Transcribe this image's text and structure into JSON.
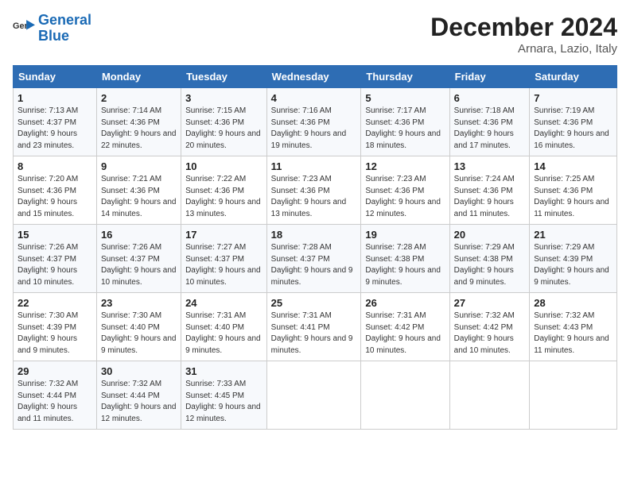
{
  "logo": {
    "line1": "General",
    "line2": "Blue"
  },
  "title": {
    "month_year": "December 2024",
    "location": "Arnara, Lazio, Italy"
  },
  "days_of_week": [
    "Sunday",
    "Monday",
    "Tuesday",
    "Wednesday",
    "Thursday",
    "Friday",
    "Saturday"
  ],
  "weeks": [
    [
      {
        "day": "1",
        "sunrise": "7:13 AM",
        "sunset": "4:37 PM",
        "daylight": "9 hours and 23 minutes."
      },
      {
        "day": "2",
        "sunrise": "7:14 AM",
        "sunset": "4:36 PM",
        "daylight": "9 hours and 22 minutes."
      },
      {
        "day": "3",
        "sunrise": "7:15 AM",
        "sunset": "4:36 PM",
        "daylight": "9 hours and 20 minutes."
      },
      {
        "day": "4",
        "sunrise": "7:16 AM",
        "sunset": "4:36 PM",
        "daylight": "9 hours and 19 minutes."
      },
      {
        "day": "5",
        "sunrise": "7:17 AM",
        "sunset": "4:36 PM",
        "daylight": "9 hours and 18 minutes."
      },
      {
        "day": "6",
        "sunrise": "7:18 AM",
        "sunset": "4:36 PM",
        "daylight": "9 hours and 17 minutes."
      },
      {
        "day": "7",
        "sunrise": "7:19 AM",
        "sunset": "4:36 PM",
        "daylight": "9 hours and 16 minutes."
      }
    ],
    [
      {
        "day": "8",
        "sunrise": "7:20 AM",
        "sunset": "4:36 PM",
        "daylight": "9 hours and 15 minutes."
      },
      {
        "day": "9",
        "sunrise": "7:21 AM",
        "sunset": "4:36 PM",
        "daylight": "9 hours and 14 minutes."
      },
      {
        "day": "10",
        "sunrise": "7:22 AM",
        "sunset": "4:36 PM",
        "daylight": "9 hours and 13 minutes."
      },
      {
        "day": "11",
        "sunrise": "7:23 AM",
        "sunset": "4:36 PM",
        "daylight": "9 hours and 13 minutes."
      },
      {
        "day": "12",
        "sunrise": "7:23 AM",
        "sunset": "4:36 PM",
        "daylight": "9 hours and 12 minutes."
      },
      {
        "day": "13",
        "sunrise": "7:24 AM",
        "sunset": "4:36 PM",
        "daylight": "9 hours and 11 minutes."
      },
      {
        "day": "14",
        "sunrise": "7:25 AM",
        "sunset": "4:36 PM",
        "daylight": "9 hours and 11 minutes."
      }
    ],
    [
      {
        "day": "15",
        "sunrise": "7:26 AM",
        "sunset": "4:37 PM",
        "daylight": "9 hours and 10 minutes."
      },
      {
        "day": "16",
        "sunrise": "7:26 AM",
        "sunset": "4:37 PM",
        "daylight": "9 hours and 10 minutes."
      },
      {
        "day": "17",
        "sunrise": "7:27 AM",
        "sunset": "4:37 PM",
        "daylight": "9 hours and 10 minutes."
      },
      {
        "day": "18",
        "sunrise": "7:28 AM",
        "sunset": "4:37 PM",
        "daylight": "9 hours and 9 minutes."
      },
      {
        "day": "19",
        "sunrise": "7:28 AM",
        "sunset": "4:38 PM",
        "daylight": "9 hours and 9 minutes."
      },
      {
        "day": "20",
        "sunrise": "7:29 AM",
        "sunset": "4:38 PM",
        "daylight": "9 hours and 9 minutes."
      },
      {
        "day": "21",
        "sunrise": "7:29 AM",
        "sunset": "4:39 PM",
        "daylight": "9 hours and 9 minutes."
      }
    ],
    [
      {
        "day": "22",
        "sunrise": "7:30 AM",
        "sunset": "4:39 PM",
        "daylight": "9 hours and 9 minutes."
      },
      {
        "day": "23",
        "sunrise": "7:30 AM",
        "sunset": "4:40 PM",
        "daylight": "9 hours and 9 minutes."
      },
      {
        "day": "24",
        "sunrise": "7:31 AM",
        "sunset": "4:40 PM",
        "daylight": "9 hours and 9 minutes."
      },
      {
        "day": "25",
        "sunrise": "7:31 AM",
        "sunset": "4:41 PM",
        "daylight": "9 hours and 9 minutes."
      },
      {
        "day": "26",
        "sunrise": "7:31 AM",
        "sunset": "4:42 PM",
        "daylight": "9 hours and 10 minutes."
      },
      {
        "day": "27",
        "sunrise": "7:32 AM",
        "sunset": "4:42 PM",
        "daylight": "9 hours and 10 minutes."
      },
      {
        "day": "28",
        "sunrise": "7:32 AM",
        "sunset": "4:43 PM",
        "daylight": "9 hours and 11 minutes."
      }
    ],
    [
      {
        "day": "29",
        "sunrise": "7:32 AM",
        "sunset": "4:44 PM",
        "daylight": "9 hours and 11 minutes."
      },
      {
        "day": "30",
        "sunrise": "7:32 AM",
        "sunset": "4:44 PM",
        "daylight": "9 hours and 12 minutes."
      },
      {
        "day": "31",
        "sunrise": "7:33 AM",
        "sunset": "4:45 PM",
        "daylight": "9 hours and 12 minutes."
      },
      null,
      null,
      null,
      null
    ]
  ]
}
